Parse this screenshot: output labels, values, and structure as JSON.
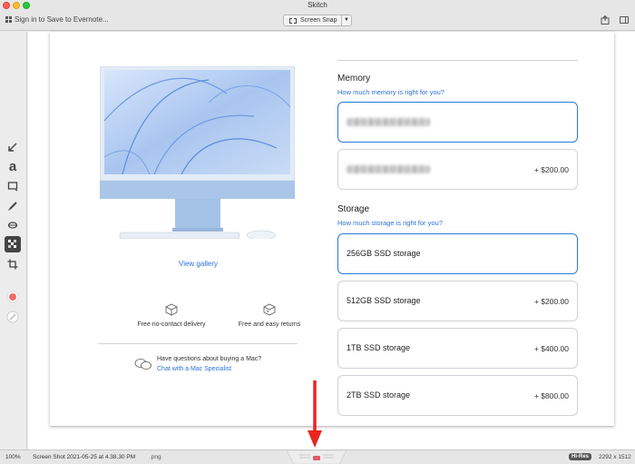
{
  "window": {
    "title": "Skitch"
  },
  "toolbar": {
    "signin_label": "Sign in to Save to Evernote...",
    "snap_label": "Screen Snap"
  },
  "product": {
    "view_gallery": "View gallery",
    "features": [
      "Free no-contact delivery",
      "Free and easy returns"
    ],
    "question": "Have questions about buying a Mac?",
    "chat_link": "Chat with a Mac Specialist"
  },
  "memory": {
    "title": "Memory",
    "link": "How much memory is right for you?",
    "options": [
      {
        "name": "",
        "price": ""
      },
      {
        "name": "",
        "price": "+ $200.00"
      }
    ]
  },
  "storage": {
    "title": "Storage",
    "link": "How much storage is right for you?",
    "options": [
      {
        "name": "256GB SSD storage",
        "price": ""
      },
      {
        "name": "512GB SSD storage",
        "price": "+ $200.00"
      },
      {
        "name": "1TB SSD storage",
        "price": "+ $400.00"
      },
      {
        "name": "2TB SSD storage",
        "price": "+ $800.00"
      }
    ]
  },
  "statusbar": {
    "zoom": "100%",
    "filename": "Screen Shot 2021-05-25 at 4.38.30 PM",
    "extension": ".png",
    "hires": "Hi-Res",
    "dimensions": "2292 x 1512"
  },
  "colors": {
    "accent_link": "#2b73d8",
    "selected_border": "#2a7ad8",
    "annotation_arrow": "#e8261f",
    "imac_blue": "#a9c6e8"
  }
}
